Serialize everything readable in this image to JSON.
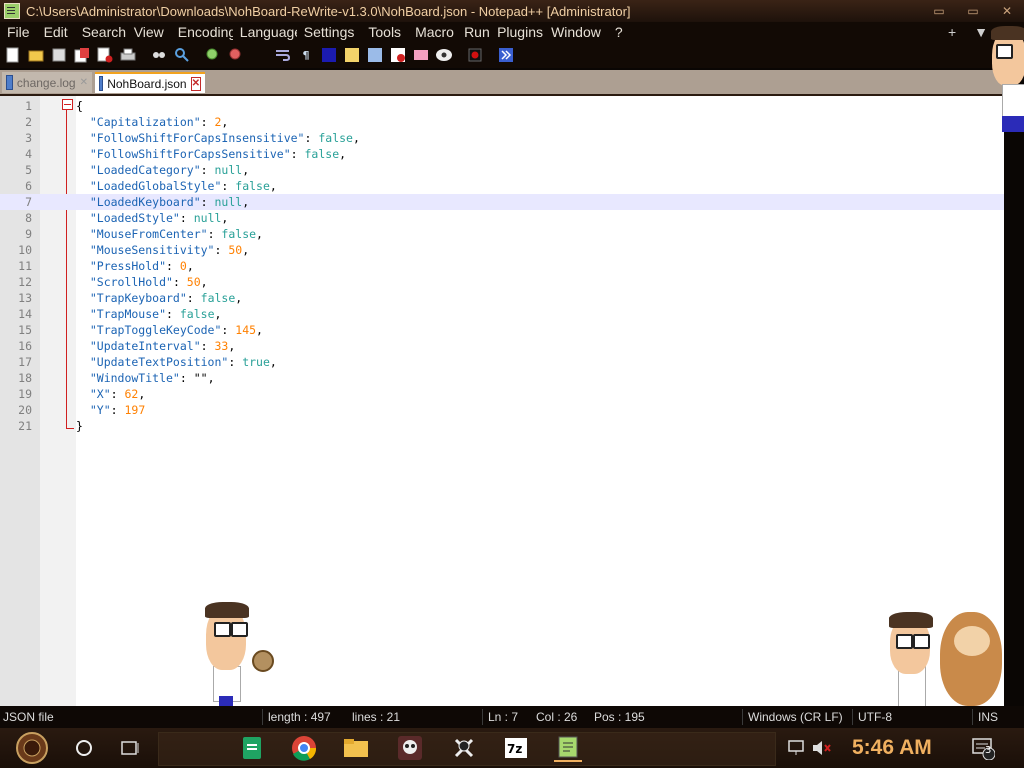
{
  "window": {
    "title": "C:\\Users\\Administrator\\Downloads\\NohBoard-ReWrite-v1.3.0\\NohBoard.json - Notepad++ [Administrator]",
    "buttons": [
      "▭",
      "▭",
      "✕"
    ]
  },
  "menu": {
    "items": [
      "File",
      "Edit",
      "Search",
      "View",
      "Encoding",
      "Language",
      "Settings",
      "Tools",
      "Macro",
      "Run",
      "Plugins",
      "Window",
      "?"
    ],
    "right": [
      "+",
      "▼"
    ]
  },
  "tabs": [
    {
      "label": "change.log",
      "active": false
    },
    {
      "label": "NohBoard.json",
      "active": true
    }
  ],
  "editor": {
    "current_line": 7,
    "lines": [
      {
        "n": "1",
        "parts": [
          {
            "t": "{",
            "c": "p"
          }
        ]
      },
      {
        "n": "2",
        "parts": [
          {
            "t": "  \"Capitalization\"",
            "c": "k"
          },
          {
            "t": ": ",
            "c": "p"
          },
          {
            "t": "2",
            "c": "n"
          },
          {
            "t": ",",
            "c": "p"
          }
        ]
      },
      {
        "n": "3",
        "parts": [
          {
            "t": "  \"FollowShiftForCapsInsensitive\"",
            "c": "k"
          },
          {
            "t": ": ",
            "c": "p"
          },
          {
            "t": "false",
            "c": "b"
          },
          {
            "t": ",",
            "c": "p"
          }
        ]
      },
      {
        "n": "4",
        "parts": [
          {
            "t": "  \"FollowShiftForCapsSensitive\"",
            "c": "k"
          },
          {
            "t": ": ",
            "c": "p"
          },
          {
            "t": "false",
            "c": "b"
          },
          {
            "t": ",",
            "c": "p"
          }
        ]
      },
      {
        "n": "5",
        "parts": [
          {
            "t": "  \"LoadedCategory\"",
            "c": "k"
          },
          {
            "t": ": ",
            "c": "p"
          },
          {
            "t": "null",
            "c": "b"
          },
          {
            "t": ",",
            "c": "p"
          }
        ]
      },
      {
        "n": "6",
        "parts": [
          {
            "t": "  \"LoadedGlobalStyle\"",
            "c": "k"
          },
          {
            "t": ": ",
            "c": "p"
          },
          {
            "t": "false",
            "c": "b"
          },
          {
            "t": ",",
            "c": "p"
          }
        ]
      },
      {
        "n": "7",
        "parts": [
          {
            "t": "  \"LoadedKeyboard\"",
            "c": "k"
          },
          {
            "t": ": ",
            "c": "p"
          },
          {
            "t": "null",
            "c": "b"
          },
          {
            "t": ",",
            "c": "p"
          }
        ]
      },
      {
        "n": "8",
        "parts": [
          {
            "t": "  \"LoadedStyle\"",
            "c": "k"
          },
          {
            "t": ": ",
            "c": "p"
          },
          {
            "t": "null",
            "c": "b"
          },
          {
            "t": ",",
            "c": "p"
          }
        ]
      },
      {
        "n": "9",
        "parts": [
          {
            "t": "  \"MouseFromCenter\"",
            "c": "k"
          },
          {
            "t": ": ",
            "c": "p"
          },
          {
            "t": "false",
            "c": "b"
          },
          {
            "t": ",",
            "c": "p"
          }
        ]
      },
      {
        "n": "10",
        "parts": [
          {
            "t": "  \"MouseSensitivity\"",
            "c": "k"
          },
          {
            "t": ": ",
            "c": "p"
          },
          {
            "t": "50",
            "c": "n"
          },
          {
            "t": ",",
            "c": "p"
          }
        ]
      },
      {
        "n": "11",
        "parts": [
          {
            "t": "  \"PressHold\"",
            "c": "k"
          },
          {
            "t": ": ",
            "c": "p"
          },
          {
            "t": "0",
            "c": "n"
          },
          {
            "t": ",",
            "c": "p"
          }
        ]
      },
      {
        "n": "12",
        "parts": [
          {
            "t": "  \"ScrollHold\"",
            "c": "k"
          },
          {
            "t": ": ",
            "c": "p"
          },
          {
            "t": "50",
            "c": "n"
          },
          {
            "t": ",",
            "c": "p"
          }
        ]
      },
      {
        "n": "13",
        "parts": [
          {
            "t": "  \"TrapKeyboard\"",
            "c": "k"
          },
          {
            "t": ": ",
            "c": "p"
          },
          {
            "t": "false",
            "c": "b"
          },
          {
            "t": ",",
            "c": "p"
          }
        ]
      },
      {
        "n": "14",
        "parts": [
          {
            "t": "  \"TrapMouse\"",
            "c": "k"
          },
          {
            "t": ": ",
            "c": "p"
          },
          {
            "t": "false",
            "c": "b"
          },
          {
            "t": ",",
            "c": "p"
          }
        ]
      },
      {
        "n": "15",
        "parts": [
          {
            "t": "  \"TrapToggleKeyCode\"",
            "c": "k"
          },
          {
            "t": ": ",
            "c": "p"
          },
          {
            "t": "145",
            "c": "n"
          },
          {
            "t": ",",
            "c": "p"
          }
        ]
      },
      {
        "n": "16",
        "parts": [
          {
            "t": "  \"UpdateInterval\"",
            "c": "k"
          },
          {
            "t": ": ",
            "c": "p"
          },
          {
            "t": "33",
            "c": "n"
          },
          {
            "t": ",",
            "c": "p"
          }
        ]
      },
      {
        "n": "17",
        "parts": [
          {
            "t": "  \"UpdateTextPosition\"",
            "c": "k"
          },
          {
            "t": ": ",
            "c": "p"
          },
          {
            "t": "true",
            "c": "b"
          },
          {
            "t": ",",
            "c": "p"
          }
        ]
      },
      {
        "n": "18",
        "parts": [
          {
            "t": "  \"WindowTitle\"",
            "c": "k"
          },
          {
            "t": ": ",
            "c": "p"
          },
          {
            "t": "\"\"",
            "c": "p"
          },
          {
            "t": ",",
            "c": "p"
          }
        ]
      },
      {
        "n": "19",
        "parts": [
          {
            "t": "  \"X\"",
            "c": "k"
          },
          {
            "t": ": ",
            "c": "p"
          },
          {
            "t": "62",
            "c": "n"
          },
          {
            "t": ",",
            "c": "p"
          }
        ]
      },
      {
        "n": "20",
        "parts": [
          {
            "t": "  \"Y\"",
            "c": "k"
          },
          {
            "t": ": ",
            "c": "p"
          },
          {
            "t": "197",
            "c": "n"
          }
        ]
      },
      {
        "n": "21",
        "parts": [
          {
            "t": "}",
            "c": "p"
          }
        ]
      }
    ]
  },
  "status": {
    "filetype": "JSON file",
    "length": "length : 497",
    "lines": "lines : 21",
    "ln": "Ln : 7",
    "col": "Col : 26",
    "pos": "Pos : 195",
    "eol": "Windows (CR LF)",
    "encoding": "UTF-8",
    "mode": "INS"
  },
  "taskbar": {
    "clock": "5:46 AM",
    "notification_count": "3"
  }
}
